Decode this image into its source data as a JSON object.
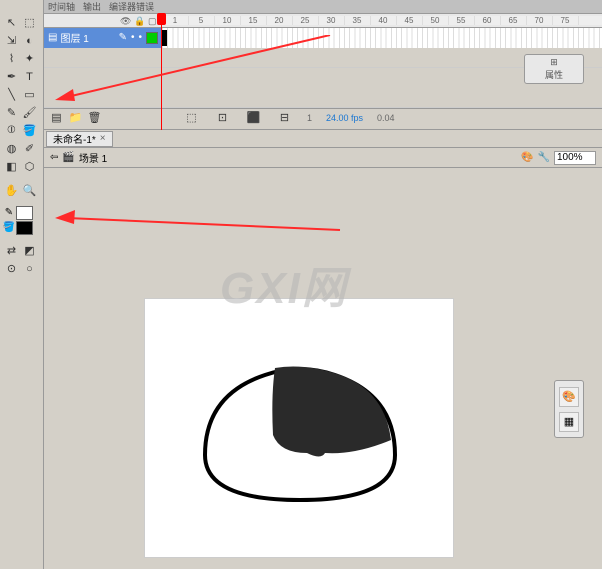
{
  "timeline": {
    "tabs": [
      "时间轴",
      "输出",
      "编译器错误"
    ],
    "layer_name": "图层 1",
    "ruler_marks": [
      "1",
      "5",
      "10",
      "15",
      "20",
      "25",
      "30",
      "35",
      "40",
      "45",
      "50",
      "55",
      "60",
      "65",
      "70",
      "75"
    ],
    "status": {
      "frame": "1",
      "fps": "24.00 fps",
      "time": "0.04"
    }
  },
  "props_panel_label": "属性",
  "document": {
    "tab_title": "未命名-1*"
  },
  "scene": {
    "label": "场景 1",
    "zoom": "100%"
  },
  "watermark": "GXI网",
  "tools": {
    "names": [
      [
        "selection-icon",
        "subselection-icon"
      ],
      [
        "free-transform-icon",
        "3d-rotation-icon"
      ],
      [
        "lasso-icon",
        "magic-wand-icon"
      ],
      [
        "pen-icon",
        "text-icon"
      ],
      [
        "line-icon",
        "rectangle-icon"
      ],
      [
        "pencil-icon",
        "brush-icon"
      ],
      [
        "bone-icon",
        "paint-bucket-icon"
      ],
      [
        "ink-bottle-icon",
        "eyedropper-icon"
      ],
      [
        "eraser-icon",
        "bone-bind-icon"
      ]
    ],
    "view_names": [
      [
        "hand-icon",
        "zoom-icon"
      ]
    ],
    "glyphs": {
      "selection-icon": "↖",
      "subselection-icon": "⬚",
      "free-transform-icon": "⇲",
      "3d-rotation-icon": "◐",
      "lasso-icon": "⌇",
      "magic-wand-icon": "✦",
      "pen-icon": "✒",
      "text-icon": "T",
      "line-icon": "╲",
      "rectangle-icon": "▭",
      "pencil-icon": "✎",
      "brush-icon": "🖌",
      "bone-icon": "⦶",
      "paint-bucket-icon": "🪣",
      "ink-bottle-icon": "◍",
      "eyedropper-icon": "✐",
      "eraser-icon": "◧",
      "bone-bind-icon": "⬡",
      "hand-icon": "✋",
      "zoom-icon": "🔍"
    }
  },
  "colors": {
    "stroke": "#ffffff",
    "fill": "#000000"
  }
}
